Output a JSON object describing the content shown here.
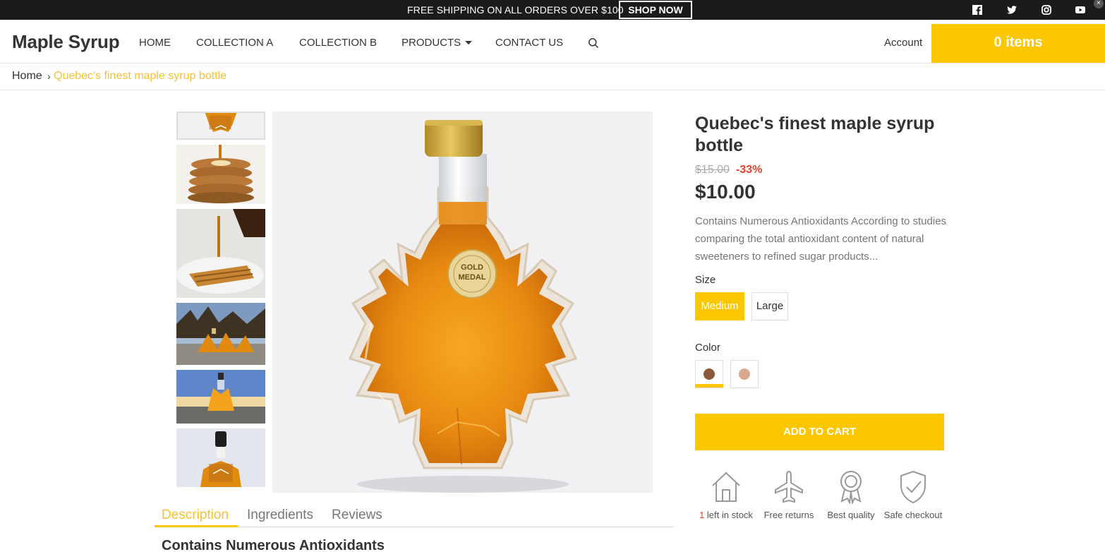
{
  "topbar": {
    "message": "FREE SHIPPING ON ALL ORDERS OVER $100",
    "cta_label": "SHOP NOW",
    "social": [
      "facebook-icon",
      "twitter-icon",
      "instagram-icon",
      "youtube-icon"
    ]
  },
  "header": {
    "logo": "Maple Syrup",
    "nav": [
      "HOME",
      "COLLECTION A",
      "COLLECTION B",
      "PRODUCTS",
      "CONTACT US"
    ],
    "account": "Account",
    "cart": "0 items"
  },
  "breadcrumb": {
    "home": "Home",
    "separator": "›",
    "current": "Quebec's finest maple syrup bottle"
  },
  "product": {
    "title": "Quebec's finest maple syrup bottle",
    "old_price": "$15.00",
    "discount": "-33%",
    "price": "$10.00",
    "description": "Contains Numerous Antioxidants According to studies comparing the total antioxidant content of natural sweeteners to refined sugar products...",
    "size_label": "Size",
    "sizes": [
      "Medium",
      "Large"
    ],
    "selected_size": "Medium",
    "color_label": "Color",
    "add_to_cart": "ADD TO CART",
    "features": {
      "stock_count": "1",
      "stock_text": " left in stock",
      "returns": "Free returns",
      "quality": "Best quality",
      "checkout": "Safe checkout"
    }
  },
  "tabs": [
    "Description",
    "Ingredients",
    "Reviews"
  ],
  "active_tab": "Description",
  "description_heading": "Contains Numerous Antioxidants",
  "colors": {
    "accent": "#fdc700",
    "accent_text": "#f5c233",
    "discount": "#e0452a",
    "topbar": "#1b1b1b",
    "swatch_1": "#8a5a3a",
    "swatch_2": "#d9a98e"
  }
}
